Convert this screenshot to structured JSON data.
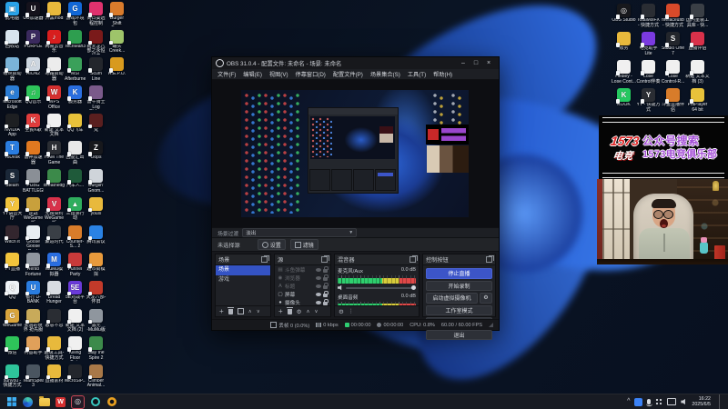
{
  "desktop": {
    "left_icons": [
      {
        "l": "此电脑",
        "c": "#2aa3e8",
        "g": "▣"
      },
      {
        "l": "UU加速器",
        "c": "#15121c",
        "g": "U"
      },
      {
        "l": "开黑mod",
        "c": "#e8b93c",
        "g": ""
      },
      {
        "l": "游戏环境包",
        "c": "#1268d8",
        "g": "G"
      },
      {
        "l": "向日葵远程控制",
        "c": "#e0326e",
        "g": ""
      },
      {
        "l": "Burger Shift Team Ru...",
        "c": "#d97b2c",
        "g": ""
      },
      {
        "l": "回收站",
        "c": "#d8e4ee",
        "g": ""
      },
      {
        "l": "PURPLE",
        "c": "#3a2a5e",
        "g": "P"
      },
      {
        "l": "网易云音乐",
        "c": "#d81e1e",
        "g": "♪"
      },
      {
        "l": "TechMan3",
        "c": "#2e9e4f",
        "g": ""
      },
      {
        "l": "新天龙八部之永恒经典",
        "c": "#7a1a1a",
        "g": ""
      },
      {
        "l": "罐头 Creek...",
        "c": "#9ec46a",
        "g": ""
      },
      {
        "l": "绘世启动器",
        "c": "#7ab3d8",
        "g": ""
      },
      {
        "l": "AION2",
        "c": "#cdd6e0",
        "g": "A"
      },
      {
        "l": "寒霜启动器",
        "c": "#ececec",
        "g": ""
      },
      {
        "l": "MSI Afterburner",
        "c": "#3aa05a",
        "g": ""
      },
      {
        "l": "Scum Line",
        "c": "#23262c",
        "g": ""
      },
      {
        "l": "R.E.P.O.",
        "c": "#d89a1e",
        "g": ""
      },
      {
        "l": "Microsoft Edge",
        "c": "#2b7cd4",
        "g": "e"
      },
      {
        "l": "QQ音乐",
        "c": "#2ec45a",
        "g": "♫"
      },
      {
        "l": "WPS Office",
        "c": "#d43030",
        "g": "W"
      },
      {
        "l": "服务器",
        "c": "#2a6ee0",
        "g": "K"
      },
      {
        "l": "雷牛骑士 Log Riders",
        "c": "#7a5a8a",
        "g": ""
      },
      {
        "l": "",
        "c": "",
        "g": "",
        "v": "hidden"
      },
      {
        "l": "NVIDIA App",
        "c": "#1d1f22",
        "g": ""
      },
      {
        "l": "全民K歌",
        "c": "#e03c3c",
        "g": "K"
      },
      {
        "l": "新建 文本文档",
        "c": "#f0f0f0",
        "g": ""
      },
      {
        "l": "QQ飞车",
        "c": "#e8c23a",
        "g": ""
      },
      {
        "l": "梵",
        "c": "#5a1f1f",
        "g": ""
      },
      {
        "l": "",
        "c": "",
        "g": "",
        "v": "hidden"
      },
      {
        "l": "ToDesk",
        "c": "#2a7de0",
        "g": "T"
      },
      {
        "l": "雷神加速器",
        "c": "#e07820",
        "g": ""
      },
      {
        "l": "HAM The Game",
        "c": "#2a2d33",
        "g": "H"
      },
      {
        "l": "回度汇出曲",
        "c": "#e8e8e8",
        "g": ""
      },
      {
        "l": "Oops",
        "c": "#17181c",
        "g": "Z"
      },
      {
        "l": "",
        "c": "",
        "g": "",
        "v": "hidden"
      },
      {
        "l": "Steam",
        "c": "#1b2838",
        "g": "S"
      },
      {
        "l": "PUBG BATTLEGR...",
        "c": "#8a8f96",
        "g": ""
      },
      {
        "l": "Breathedge",
        "c": "#3c8a4a",
        "g": ""
      },
      {
        "l": "汽车人...",
        "c": "#1f5a3a",
        "g": ""
      },
      {
        "l": "Burglin' Gnom...",
        "c": "#cfd4da",
        "g": ""
      },
      {
        "l": "",
        "c": "",
        "g": "",
        "v": "hidden"
      },
      {
        "l": "YY语音大厅",
        "c": "#f2c43c",
        "g": "Y"
      },
      {
        "l": "逆战 WeGame版",
        "c": "#c8a03c",
        "g": ""
      },
      {
        "l": "无畏契约 WeGame版",
        "c": "#d8314a",
        "g": "V"
      },
      {
        "l": "三角洲行动",
        "c": "#2fae5e",
        "g": "▲"
      },
      {
        "l": "youxi",
        "c": "#e8b93c",
        "g": ""
      },
      {
        "l": "",
        "c": "",
        "g": "",
        "v": "hidden"
      },
      {
        "l": "Witch It",
        "c": "#33262e",
        "g": ""
      },
      {
        "l": "Goose Goose Duck",
        "c": "#e8eef2",
        "g": ""
      },
      {
        "l": "聚造时代",
        "c": "#3a3f46",
        "g": ""
      },
      {
        "l": "Counter-S... 2",
        "c": "#d87c2a",
        "g": ""
      },
      {
        "l": "腾讯会议",
        "c": "#2a82e4",
        "g": ""
      },
      {
        "l": "",
        "c": "",
        "g": "",
        "v": "hidden"
      },
      {
        "l": "YY直播",
        "c": "#f2c43c",
        "g": ""
      },
      {
        "l": "Rento Fortune -...",
        "c": "#8f969e",
        "g": ""
      },
      {
        "l": "MuMu模拟器",
        "c": "#2a6ee0",
        "g": "M"
      },
      {
        "l": "Funnel Party",
        "c": "#c83a3a",
        "g": ""
      },
      {
        "l": "超市街模拟",
        "c": "#e89a3c",
        "g": ""
      },
      {
        "l": "",
        "c": "",
        "g": "",
        "v": "hidden"
      },
      {
        "l": "QQ",
        "c": "#eef2f6",
        "g": "Q"
      },
      {
        "l": "银行 U-BANK",
        "c": "#2a7de0",
        "g": "U"
      },
      {
        "l": "Dread Hunger",
        "c": "#d8dce2",
        "g": ""
      },
      {
        "l": "5E对战平台",
        "c": "#6a3ad8",
        "g": "5E"
      },
      {
        "l": "天龙八部-怀旧",
        "c": "#c23a2a",
        "g": ""
      },
      {
        "l": "",
        "c": "",
        "g": "",
        "v": "hidden"
      },
      {
        "l": "WeGame",
        "c": "#d8a43c",
        "g": "G"
      },
      {
        "l": "失落的世界 抢先服",
        "c": "#c8aa5a",
        "g": ""
      },
      {
        "l": "恶意不息",
        "c": "#2a2d33",
        "g": ""
      },
      {
        "l": "新建 文本文档 (2)",
        "c": "#f0f0f0",
        "g": ""
      },
      {
        "l": "激光·MuMu版",
        "c": "#8f969e",
        "g": ""
      },
      {
        "l": "",
        "c": "",
        "g": "",
        "v": "hidden"
      },
      {
        "l": "微信",
        "c": "#2ec45a",
        "g": ""
      },
      {
        "l": "柯基助手",
        "c": "#e0a05a",
        "g": ""
      },
      {
        "l": "超级工具-快捷方式",
        "c": "#e8b93c",
        "g": ""
      },
      {
        "l": "Killing Floor Beta Dedi...",
        "c": "#f0f0f0",
        "g": ""
      },
      {
        "l": "Slay the Spire 2",
        "c": "#3c8a4a",
        "g": ""
      },
      {
        "l": "",
        "c": "",
        "g": "",
        "v": "hidden"
      },
      {
        "l": "sunyou - 快捷方式",
        "c": "#2ec49a",
        "g": ""
      },
      {
        "l": "TeamSpeak 3",
        "c": "#4a5560",
        "g": ""
      },
      {
        "l": "直播素材",
        "c": "#e8b93c",
        "g": ""
      },
      {
        "l": "MicroSIP...",
        "c": "#23262c",
        "g": ""
      },
      {
        "l": "Climber Animal...",
        "c": "#a87848",
        "g": ""
      },
      {
        "l": "",
        "c": "",
        "g": "",
        "v": "hidden"
      }
    ],
    "right_icons": [
      {
        "l": "OBS Studio",
        "c": "#17181c",
        "g": "◎"
      },
      {
        "l": "TotalMixFX - 快捷方式",
        "c": "#2a2d33",
        "g": ""
      },
      {
        "l": "firefaceusb - 快捷方式",
        "c": "#d84a2a",
        "g": ""
      },
      {
        "l": "国内重装工具库 - 快...",
        "c": "#3a3f46",
        "g": ""
      },
      {
        "l": "账务",
        "c": "#e8b93c",
        "g": ""
      },
      {
        "l": "电竞助手Lite",
        "c": "#7a3ae0",
        "g": ""
      },
      {
        "l": "Studio One 7",
        "c": "#23262c",
        "g": "S"
      },
      {
        "l": "直播伴侣",
        "c": "#d8314a",
        "g": ""
      },
      {
        "l": "Hedley - Lose Cont...",
        "c": "#f0f0f0",
        "g": ""
      },
      {
        "l": "Lose Control伴奏",
        "c": "#f0f0f0",
        "g": ""
      },
      {
        "l": "Lose Control-R...",
        "c": "#f0f0f0",
        "g": ""
      },
      {
        "l": "新建 文本文档 (3)",
        "c": "#f0f0f0",
        "g": ""
      },
      {
        "l": "KOOK",
        "c": "#26c860",
        "g": "K"
      },
      {
        "l": "YY - 快捷方式",
        "c": "#2a2d33",
        "g": "Y"
      },
      {
        "l": "斗鱼直播伴侣",
        "c": "#d87c2a",
        "g": ""
      },
      {
        "l": "PotPlayer 64 bit",
        "c": "#e8c23a",
        "g": ""
      }
    ]
  },
  "banner": {
    "logo_top": "1573",
    "logo_bottom": "电竞",
    "line1": "公众号搜索",
    "line2": "1573电竞俱乐部",
    "text_color": "#a44fd6",
    "logo_color": "#e02626"
  },
  "obs": {
    "title": "OBS 31.0.4 - 配置文件: 未命名 - 场景: 未命名",
    "win": {
      "min": "–",
      "max": "□",
      "close": "×"
    },
    "menus": [
      "文件(F)",
      "编辑(E)",
      "视图(V)",
      "停靠窗口(D)",
      "配置文件(P)",
      "场景集合(S)",
      "工具(T)",
      "帮助(H)"
    ],
    "transition_label": "场景过渡",
    "transition_value": "淡出",
    "toolbar": {
      "no_source": "未选择源",
      "settings": "设置",
      "filters": "滤镜"
    },
    "panels": {
      "scenes": {
        "title": "场景",
        "items": [
          {
            "l": "场景",
            "sel": true
          },
          {
            "l": "游戏"
          }
        ]
      },
      "sources": {
        "title": "源",
        "items": [
          {
            "g": "▤",
            "l": "斗鱼弹幕",
            "dim": true
          },
          {
            "g": "◉",
            "l": "浏览器",
            "dim": true
          },
          {
            "g": "A",
            "l": "标题",
            "dim": true
          },
          {
            "g": "▢",
            "l": "屏幕",
            "dim": false
          },
          {
            "g": "●",
            "l": "摄像头",
            "dim": false
          },
          {
            "g": "▨",
            "l": "图像",
            "dim": true
          }
        ]
      },
      "mixer": {
        "title": "混音器",
        "channels": [
          {
            "name": "麦克风/Aux",
            "db": "0.0 dB"
          },
          {
            "name": "桌面音频",
            "db": "0.0 dB"
          }
        ]
      },
      "controls": {
        "title": "控制按钮",
        "buttons": [
          "停止直播",
          "开始录制",
          "启动虚拟摄像机",
          "工作室模式",
          "设置",
          "退出"
        ]
      }
    },
    "status": {
      "dropped": "丢帧 0 (0.0%)",
      "bitrate": "0 kbps",
      "live": "00:00:00",
      "rec": "00:00:00",
      "cpu": "CPU: 0.8%",
      "fps": "60.00 / 60.00 FPS"
    }
  },
  "taskbar": {
    "apps": [
      "start",
      "edge",
      "file-explorer",
      "wps-office",
      "obs-studio",
      "screen-recorder",
      "settings-tool"
    ],
    "active_app": "obs-studio"
  },
  "tray": {
    "icons": [
      "chevron-up",
      "tray-app",
      "microphone",
      "ime",
      "display",
      "volume"
    ],
    "time": "16:22",
    "date": "2025/6/5"
  }
}
